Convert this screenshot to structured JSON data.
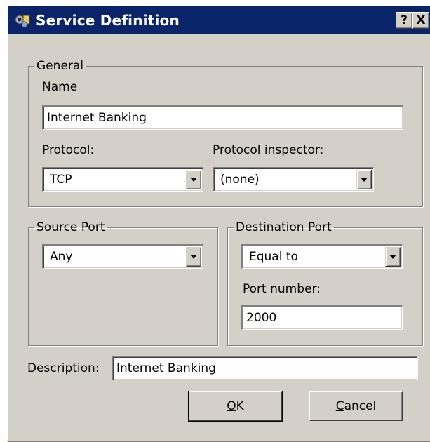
{
  "window": {
    "title": "Service Definition",
    "help_label": "?",
    "close_label": "X",
    "icon": "service-definition-icon"
  },
  "general": {
    "legend": "General",
    "name_label": "Name",
    "name_value": "Internet Banking",
    "protocol_label": "Protocol:",
    "protocol_value": "TCP",
    "inspector_label": "Protocol inspector:",
    "inspector_value": "(none)"
  },
  "source_port": {
    "legend": "Source Port",
    "value": "Any"
  },
  "destination_port": {
    "legend": "Destination Port",
    "value": "Equal to",
    "port_number_label": "Port number:",
    "port_number_value": "2000"
  },
  "description": {
    "label": "Description:",
    "value": "Internet Banking"
  },
  "buttons": {
    "ok_mnemonic": "O",
    "ok_rest": "K",
    "cancel_mnemonic": "C",
    "cancel_rest": "ancel"
  },
  "colors": {
    "titlebar": "#0a246a",
    "dialog": "#d4d0c8"
  }
}
